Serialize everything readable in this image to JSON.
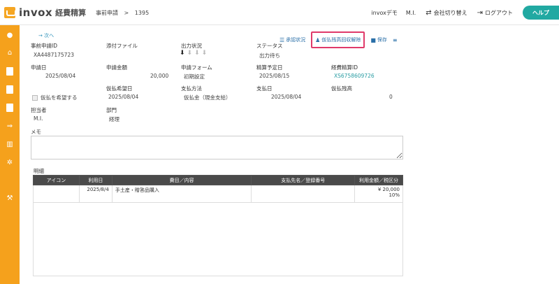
{
  "header": {
    "logo_text": "invox",
    "logo_sub": "経費精算",
    "breadcrumb": [
      "事前申請",
      ">",
      "1395"
    ],
    "company": "invoxデモ",
    "user": "M.I.",
    "switch_company": "会社切り替え",
    "logout": "ログアウト",
    "help": "ヘルプ"
  },
  "nav": {
    "next": "→ 次へ"
  },
  "toolbar": {
    "approval_status": "承認状況",
    "release_advance": "仮払残高回収解除",
    "save": "保存"
  },
  "fields": {
    "pre_app_id_label": "事前申請ID",
    "pre_app_id": "XA4487175723",
    "attachment_label": "添付ファイル",
    "output_status_label": "出力状況",
    "status_label": "ステータス",
    "status": "出力待ち",
    "app_date_label": "申請日",
    "app_date": "2025/08/04",
    "app_amount_label": "申請金額",
    "app_amount": "20,000",
    "app_form_label": "申請フォーム",
    "app_form": "初期設定",
    "settle_date_label": "精算予定日",
    "settle_date": "2025/08/15",
    "expense_id_label": "経費精算ID",
    "expense_id": "XS6758609726",
    "advance_req_label": "仮払を希望する",
    "advance_date_label": "仮払希望日",
    "advance_date": "2025/08/04",
    "pay_method_label": "支払方法",
    "pay_method": "仮払金（現金支給）",
    "pay_date_label": "支払日",
    "pay_date": "2025/08/04",
    "advance_balance_label": "仮払残高",
    "advance_balance": "0",
    "person_label": "担当者",
    "person": "M.I.",
    "dept_label": "部門",
    "dept": "経理",
    "memo_label": "メモ",
    "details_label": "明細"
  },
  "table": {
    "headers": [
      "アイコン",
      "利用日",
      "費目／内容",
      "支払先名／登録番号",
      "利用金額／税区分"
    ],
    "rows": [
      {
        "icon": "",
        "date": "2025/8/4",
        "item": "手土産・贈答品購入",
        "payee": "",
        "amount": "¥ 20,000",
        "tax": "10%"
      }
    ]
  },
  "colors": {
    "accent": "#f5a11c",
    "teal": "#21a9a2",
    "highlight": "#e03a6a"
  }
}
